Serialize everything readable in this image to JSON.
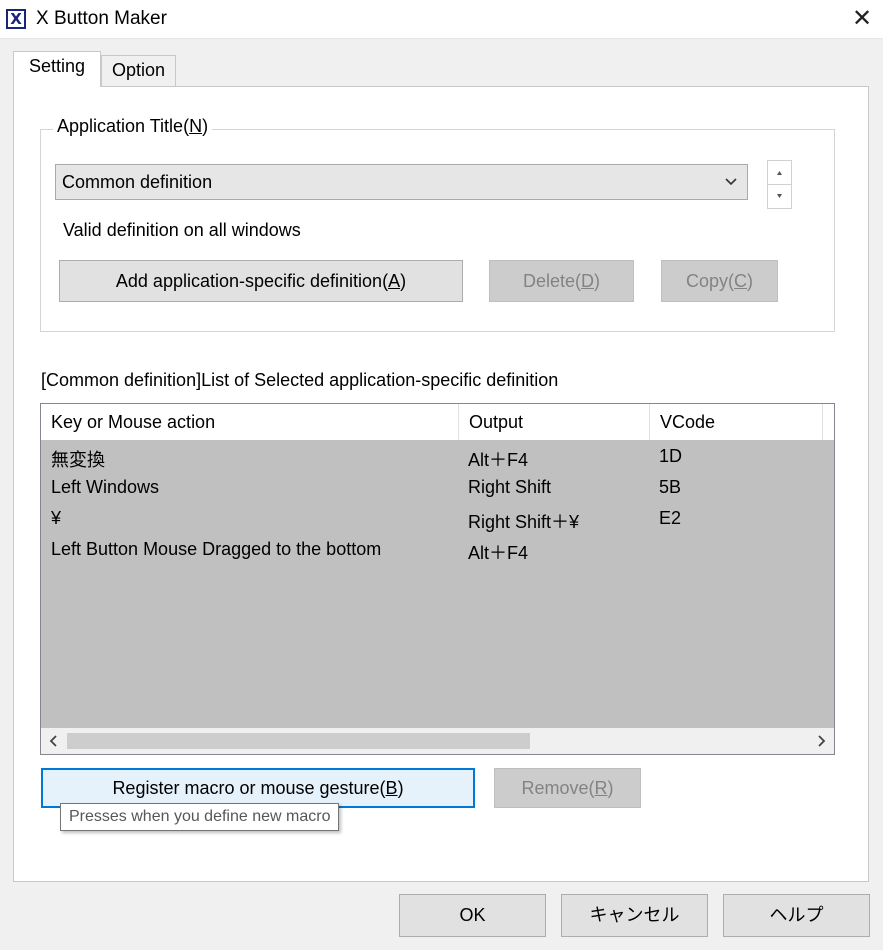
{
  "window": {
    "title": "X Button Maker"
  },
  "tabs": [
    {
      "label": "Setting",
      "active": true
    },
    {
      "label": "Option",
      "active": false
    }
  ],
  "app_group": {
    "legend": "Application Title(",
    "legend_key": "N",
    "legend_end": ")",
    "selected": "Common definition",
    "description": "Valid definition on all windows",
    "buttons": {
      "add": {
        "pre": "Add application-specific definition(",
        "key": "A",
        "post": ")"
      },
      "delete": {
        "pre": "Delete(",
        "key": "D",
        "post": ")"
      },
      "copy": {
        "pre": "Copy(",
        "key": "C",
        "post": ")"
      }
    }
  },
  "list": {
    "caption": "[Common definition]List of Selected application-specific definition",
    "columns": [
      "Key or Mouse action",
      "Output",
      "VCode"
    ],
    "rows": [
      {
        "action": "無変換",
        "output": "Alt＋F4",
        "vcode": "1D"
      },
      {
        "action": "Left Windows",
        "output": "Right Shift",
        "vcode": "5B"
      },
      {
        "action": "¥",
        "output": "Right Shift＋¥",
        "vcode": "E2"
      },
      {
        "action": "Left Button Mouse Dragged to the bottom",
        "output": "Alt＋F4",
        "vcode": ""
      }
    ]
  },
  "actions": {
    "register": {
      "pre": "Register macro or mouse gesture(",
      "key": "B",
      "post": ")"
    },
    "remove": {
      "pre": "Remove(",
      "key": "R",
      "post": ")"
    },
    "tooltip": "Presses when you define new macro"
  },
  "footer": {
    "ok": "OK",
    "cancel": "キャンセル",
    "help": "ヘルプ"
  },
  "colors": {
    "accent": "#0078d7",
    "list_background": "#c0c0c0"
  }
}
